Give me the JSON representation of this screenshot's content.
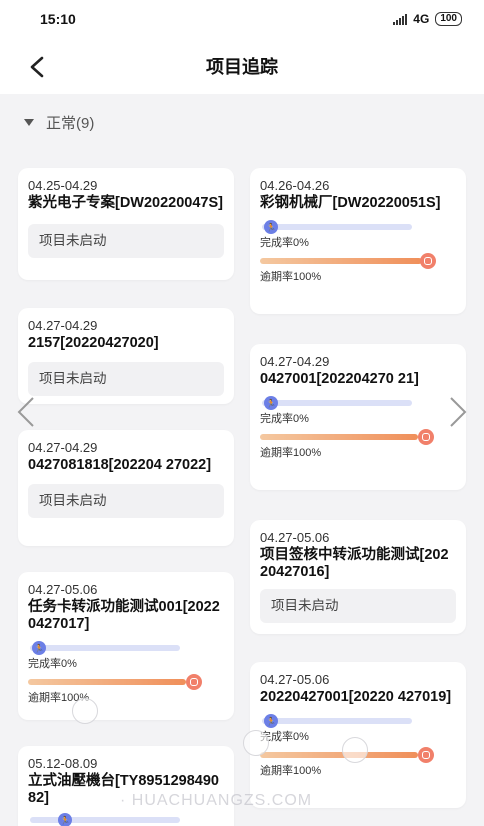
{
  "status": {
    "time": "15:10",
    "network": "4G",
    "battery": "100"
  },
  "header": {
    "title": "项目追踪"
  },
  "section": {
    "label": "正常(9)"
  },
  "cards": [
    {
      "date": "04.25-04.29",
      "title": "紫光电子专案[DW20220047S]",
      "state": "项目未启动"
    },
    {
      "date": "04.26-04.26",
      "title": "彩钢机械厂[DW20220051S]",
      "completion_label": "完成率0%",
      "completion": 0,
      "overdue_label": "逾期率100%",
      "overdue": 100
    },
    {
      "date": "04.27-04.29",
      "title": "2157[20220427020]",
      "state": "项目未启动"
    },
    {
      "date": "04.27-04.29",
      "title": "0427001[202204270 21]",
      "completion_label": "完成率0%",
      "completion": 0,
      "overdue_label": "逾期率100%",
      "overdue": 100
    },
    {
      "date": "04.27-04.29",
      "title": "0427081818[202204 27022]",
      "state": "项目未启动"
    },
    {
      "date": "04.27-05.06",
      "title": "项目签核中转派功能测试[20220427016]",
      "state": "项目未启动"
    },
    {
      "date": "04.27-05.06",
      "title": "任务卡转派功能测试001[20220427017]",
      "completion_label": "完成率0%",
      "completion": 0,
      "overdue_label": "逾期率100%",
      "overdue": 100
    },
    {
      "date": "04.27-05.06",
      "title": "20220427001[20220 427019]",
      "completion_label": "完成率0%",
      "completion": 0,
      "overdue_label": "逾期率100%",
      "overdue": 100
    },
    {
      "date": "05.12-08.09",
      "title": "立式油壓機台[TY895129849082]"
    }
  ],
  "watermark": "· HUACHUANGZS.COM",
  "colors": {
    "accent_blue": "#6c7fe6",
    "overdue_orange": "#f08f5a",
    "background": "#f3f3f5"
  }
}
